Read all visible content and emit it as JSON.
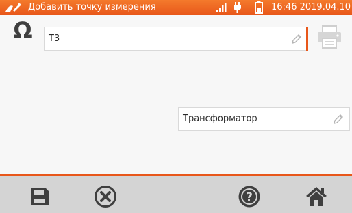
{
  "status_bar": {
    "title": "Добавить точку измерения",
    "time": "16:46",
    "date": "2019.04.10",
    "icons": [
      "measurement-app-icon",
      "signal-icon",
      "plug-icon",
      "battery-icon"
    ]
  },
  "measurement_point": {
    "icon": "ohm-icon",
    "symbol": "Ω",
    "name_value": "T3",
    "device_value": "Трансформатор"
  },
  "toolbar": {
    "buttons": [
      "save-icon",
      "cancel-icon",
      "help-icon",
      "home-icon"
    ]
  },
  "colors": {
    "accent": "#e8571a",
    "icon_dark": "#3f3f3f",
    "toolbar_bg": "#d4d4d4",
    "content_bg": "#f7f7f7"
  }
}
